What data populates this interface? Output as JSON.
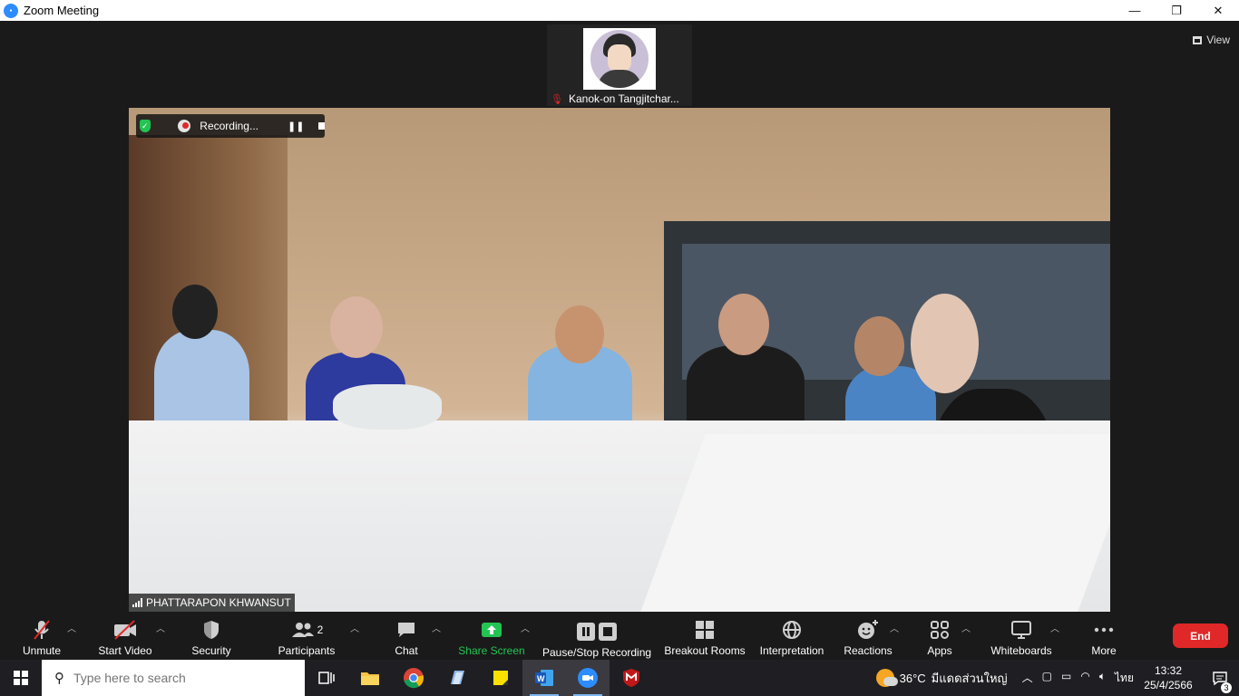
{
  "window": {
    "title": "Zoom Meeting",
    "minimize_glyph": "—",
    "restore_glyph": "❐",
    "close_glyph": "✕"
  },
  "thumbnail": {
    "participant_name": "Kanok-on Tangjitchar...",
    "mic_status_icon": "mic-muted-icon"
  },
  "view_button": {
    "label": "View"
  },
  "recording": {
    "label": "Recording...",
    "pause_glyph": "❚❚"
  },
  "main_video": {
    "name_tag": "PHATTARAPON KHWANSUT"
  },
  "toolbar": {
    "unmute": "Unmute",
    "start_video": "Start Video",
    "security": "Security",
    "participants": "Participants",
    "participants_count": "2",
    "chat": "Chat",
    "share_screen": "Share Screen",
    "pause_stop_recording": "Pause/Stop Recording",
    "breakout_rooms": "Breakout Rooms",
    "interpretation": "Interpretation",
    "reactions": "Reactions",
    "apps": "Apps",
    "whiteboards": "Whiteboards",
    "more": "More",
    "end": "End"
  },
  "taskbar": {
    "search_placeholder": "Type here to search",
    "weather_temp": "36°C",
    "weather_desc": "มีแดดส่วนใหญ่",
    "language": "ไทย",
    "time": "13:32",
    "date": "25/4/2566",
    "notification_count": "3"
  },
  "colors": {
    "accent_green": "#23c552",
    "end_red": "#e02828",
    "zoom_blue": "#2d8cff",
    "toolbar_bg": "#1a1a1a"
  }
}
